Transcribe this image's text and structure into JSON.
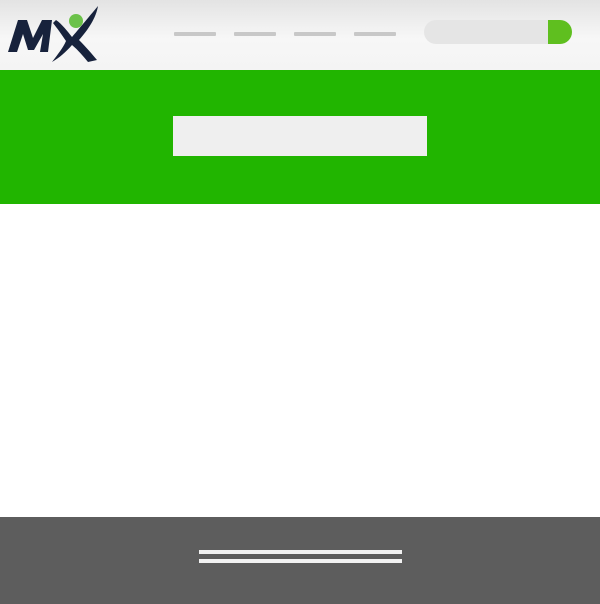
{
  "header": {
    "logo_text": "MX",
    "nav_links": [
      "",
      "",
      "",
      ""
    ],
    "search": {
      "placeholder": "",
      "button_icon": "search-go-icon"
    }
  },
  "hero": {
    "box_text": ""
  },
  "footer": {
    "lines": [
      "",
      ""
    ]
  },
  "colors": {
    "header_bg": "#f2f2f2",
    "hero_green": "#21b500",
    "accent_green": "#5fbf1f",
    "logo_navy": "#17223c",
    "footer_bg": "#5d5d5d"
  }
}
